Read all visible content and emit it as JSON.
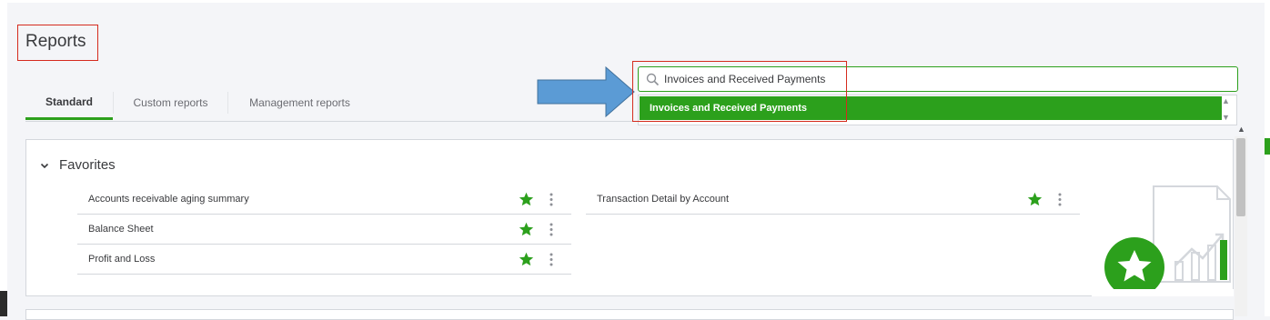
{
  "header": {
    "title": "Reports"
  },
  "tabs": [
    {
      "label": "Standard",
      "active": true
    },
    {
      "label": "Custom reports",
      "active": false
    },
    {
      "label": "Management reports",
      "active": false
    }
  ],
  "search": {
    "value": "Invoices and Received Payments",
    "suggestion": "Invoices and Received Payments",
    "icon": "search-icon"
  },
  "favorites": {
    "title": "Favorites",
    "left_items": [
      {
        "label": "Accounts receivable aging summary",
        "starred": true
      },
      {
        "label": "Balance Sheet",
        "starred": true
      },
      {
        "label": "Profit and Loss",
        "starred": true
      }
    ],
    "right_items": [
      {
        "label": "Transaction Detail by Account",
        "starred": true
      }
    ]
  },
  "colors": {
    "accent_green": "#2ca01c",
    "annotation_red": "#d52b1e",
    "annotation_arrow": "#5b9bd5",
    "text": "#393a3d",
    "border": "#d4d7dc"
  }
}
